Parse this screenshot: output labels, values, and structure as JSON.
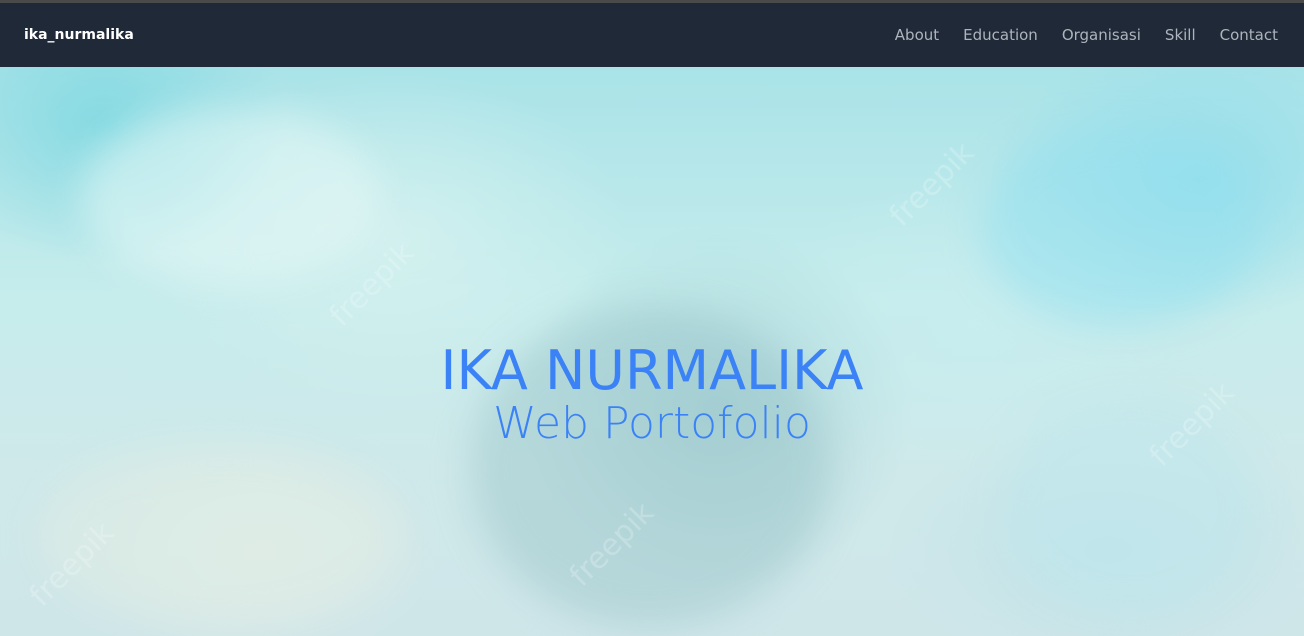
{
  "navbar": {
    "brand": "ika_nurmalika",
    "links": [
      {
        "label": "About"
      },
      {
        "label": "Education"
      },
      {
        "label": "Organisasi"
      },
      {
        "label": "Skill"
      },
      {
        "label": "Contact"
      }
    ]
  },
  "hero": {
    "title": "IKA NURMALIKA",
    "subtitle": "Web Portofolio",
    "watermark_text": "freepik"
  },
  "colors": {
    "navbar_bg": "#1f2937",
    "accent_text": "#3b82f6",
    "nav_link": "#aeb4bd",
    "brand_text": "#ffffff"
  }
}
